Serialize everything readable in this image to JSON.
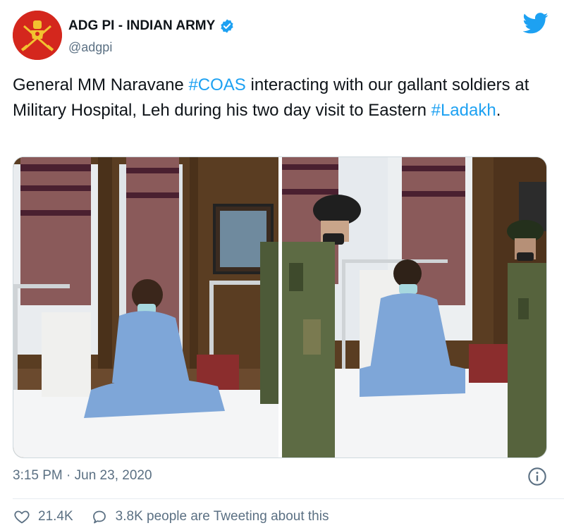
{
  "account": {
    "name": "ADG PI - INDIAN ARMY",
    "handle": "@adgpi",
    "verified": true
  },
  "tweet": {
    "text_parts": [
      {
        "text": "General MM Naravane ",
        "type": "plain"
      },
      {
        "text": "#COAS",
        "type": "hashtag"
      },
      {
        "text": " interacting with our gallant soldiers at Military Hospital, Leh during his two day visit to Eastern ",
        "type": "plain"
      },
      {
        "text": "#Ladakh",
        "type": "hashtag"
      },
      {
        "text": ".",
        "type": "plain"
      }
    ],
    "timestamp": "3:15 PM · Jun 23, 2020"
  },
  "actions": {
    "likes": "21.4K",
    "retweets_text": "3.8K people are Tweeting about this"
  },
  "icons": {
    "verified": "verified-badge-icon",
    "brand": "twitter-bird-icon",
    "info": "info-icon",
    "like": "heart-icon",
    "reply": "speech-bubble-icon"
  },
  "colors": {
    "hashtag": "#1da1f2",
    "secondary_text": "#5b7083",
    "avatar_bg": "#d4271d",
    "brand": "#1da1f2"
  }
}
